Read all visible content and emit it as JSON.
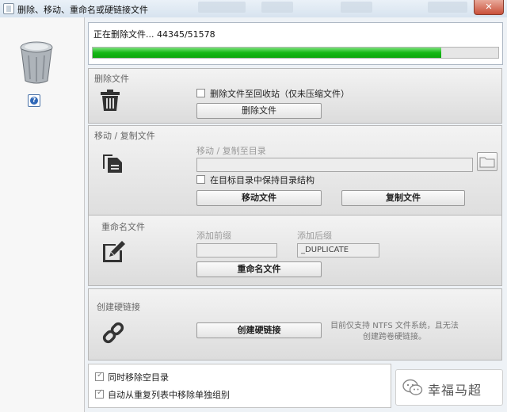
{
  "window": {
    "title": "删除、移动、重命名或硬链接文件",
    "close_label": "✕"
  },
  "progress": {
    "status_text": "正在删除文件... 44345/51578",
    "fraction": 0.86
  },
  "delete_section": {
    "title": "删除文件",
    "recycle_checkbox_label": "删除文件至回收站（仅未压缩文件）",
    "recycle_checked": false,
    "button_label": "删除文件"
  },
  "move_section": {
    "title": "移动 / 复制文件",
    "target_label": "移动 / 复制至目录",
    "target_value": "",
    "keep_structure_label": "在目标目录中保持目录结构",
    "keep_structure_checked": false,
    "move_button_label": "移动文件",
    "copy_button_label": "复制文件"
  },
  "rename_section": {
    "title": "重命名文件",
    "prefix_label": "添加前缀",
    "prefix_value": "",
    "suffix_label": "添加后缀",
    "suffix_value": "_DUPLICATE",
    "button_label": "重命名文件"
  },
  "hardlink_section": {
    "title": "创建硬链接",
    "button_label": "创建硬链接",
    "note": "目前仅支持 NTFS 文件系统，且无法创建跨卷硬链接。"
  },
  "options": {
    "remove_empty_dirs_label": "同时移除空目录",
    "remove_empty_dirs_checked": true,
    "remove_single_groups_label": "自动从重复列表中移除单独组别",
    "remove_single_groups_checked": true
  },
  "watermark": {
    "text": "幸福马超",
    "icon": "wechat-icon"
  },
  "colors": {
    "progress_green": "#16b816",
    "close_red": "#c9503a",
    "help_blue": "#2f68b8"
  }
}
